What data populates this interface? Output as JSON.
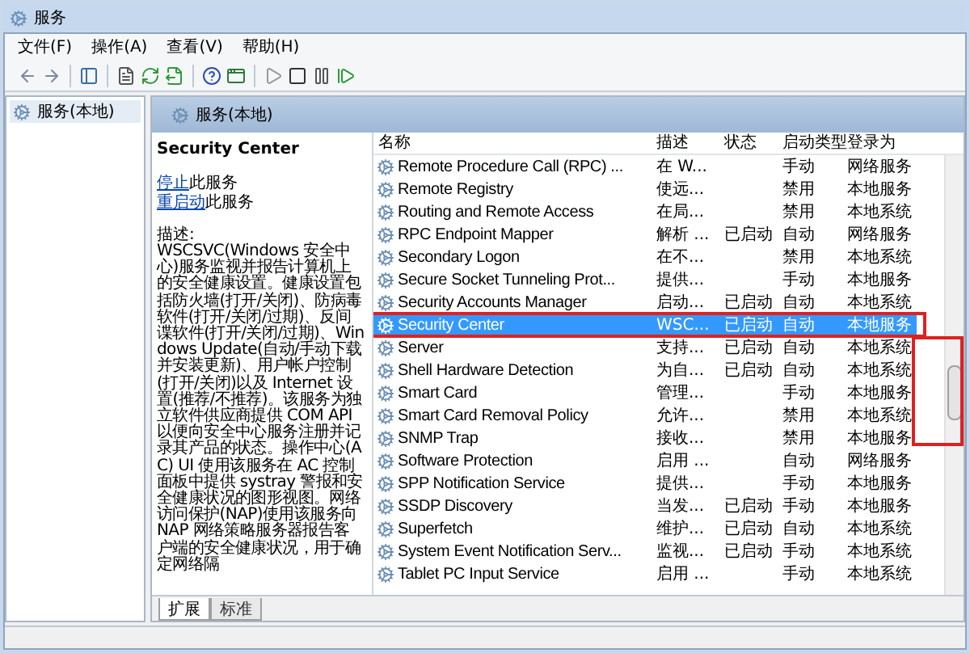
{
  "window": {
    "title": "服务"
  },
  "menu": [
    "文件(F)",
    "操作(A)",
    "查看(V)",
    "帮助(H)"
  ],
  "tree": {
    "items": [
      {
        "label": "服务(本地)",
        "selected": true
      }
    ]
  },
  "header": {
    "title": "服务(本地)"
  },
  "details": {
    "title": "Security Center",
    "actions": [
      {
        "link": "停止",
        "text": "此服务"
      },
      {
        "link": "重启动",
        "text": "此服务"
      }
    ],
    "description_label": "描述:",
    "description": "WSCSVC(Windows 安全中心)服务监视并报告计算机上的安全健康设置。健康设置包括防火墙(打开/关闭)、防病毒软件(打开/关闭/过期)、反间谍软件(打开/关闭/过期)、Windows Update(自动/手动下载并安装更新)、用户帐户控制(打开/关闭)以及 Internet 设置(推荐/不推荐)。该服务为独立软件供应商提供 COM API 以便向安全中心服务注册并记录其产品的状态。操作中心(AC) UI 使用该服务在 AC 控制面板中提供 systray 警报和安全健康状况的图形视图。网络访问保护(NAP)使用该服务向 NAP 网络策略服务器报告客户端的安全健康状况，用于确定网络隔"
  },
  "table": {
    "columns": [
      "名称",
      "描述",
      "状态",
      "启动类型",
      "登录为"
    ],
    "rows": [
      {
        "name": "Remote Procedure Call (RPC) ...",
        "description": "在 W...",
        "startup": "手动",
        "logon": "网络服务",
        "selected": false
      },
      {
        "name": "Remote Registry",
        "description": "使远...",
        "startup": "禁用",
        "logon": "本地服务",
        "selected": false
      },
      {
        "name": "Routing and Remote Access",
        "description": "在局...",
        "startup": "禁用",
        "logon": "本地系统",
        "selected": false
      },
      {
        "name": "RPC Endpoint Mapper",
        "description": "解析 ...",
        "status": "已启动",
        "startup": "自动",
        "logon": "网络服务",
        "selected": false
      },
      {
        "name": "Secondary Logon",
        "description": "在不...",
        "startup": "禁用",
        "logon": "本地系统",
        "selected": false
      },
      {
        "name": "Secure Socket Tunneling Prot...",
        "description": "提供...",
        "startup": "手动",
        "logon": "本地服务",
        "selected": false
      },
      {
        "name": "Security Accounts Manager",
        "description": "启动...",
        "status": "已启动",
        "startup": "自动",
        "logon": "本地系统",
        "selected": false
      },
      {
        "name": "Security Center",
        "description": "WSC...",
        "status": "已启动",
        "startup": "自动",
        "logon": "本地服务",
        "selected": true
      },
      {
        "name": "Server",
        "description": "支持...",
        "status": "已启动",
        "startup": "自动",
        "logon": "本地系统",
        "selected": false
      },
      {
        "name": "Shell Hardware Detection",
        "description": "为自...",
        "status": "已启动",
        "startup": "自动",
        "logon": "本地系统",
        "selected": false
      },
      {
        "name": "Smart Card",
        "description": "管理...",
        "startup": "手动",
        "logon": "本地服务",
        "selected": false
      },
      {
        "name": "Smart Card Removal Policy",
        "description": "允许...",
        "startup": "禁用",
        "logon": "本地系统",
        "selected": false
      },
      {
        "name": "SNMP Trap",
        "description": "接收...",
        "startup": "禁用",
        "logon": "本地服务",
        "selected": false
      },
      {
        "name": "Software Protection",
        "description": "启用 ...",
        "startup": "自动",
        "logon": "网络服务",
        "selected": false
      },
      {
        "name": "SPP Notification Service",
        "description": "提供...",
        "startup": "手动",
        "logon": "本地服务",
        "selected": false
      },
      {
        "name": "SSDP Discovery",
        "description": "当发...",
        "status": "已启动",
        "startup": "手动",
        "logon": "本地服务",
        "selected": false
      },
      {
        "name": "Superfetch",
        "description": "维护...",
        "status": "已启动",
        "startup": "自动",
        "logon": "本地系统",
        "selected": false
      },
      {
        "name": "System Event Notification Serv...",
        "description": "监视...",
        "status": "已启动",
        "startup": "手动",
        "logon": "本地系统",
        "selected": false
      },
      {
        "name": "Tablet PC Input Service",
        "description": "启用 ...",
        "startup": "手动",
        "logon": "本地系统",
        "selected": false
      }
    ]
  },
  "tabs": [
    {
      "label": "扩展",
      "selected": true
    },
    {
      "label": "标准",
      "selected": false
    }
  ]
}
